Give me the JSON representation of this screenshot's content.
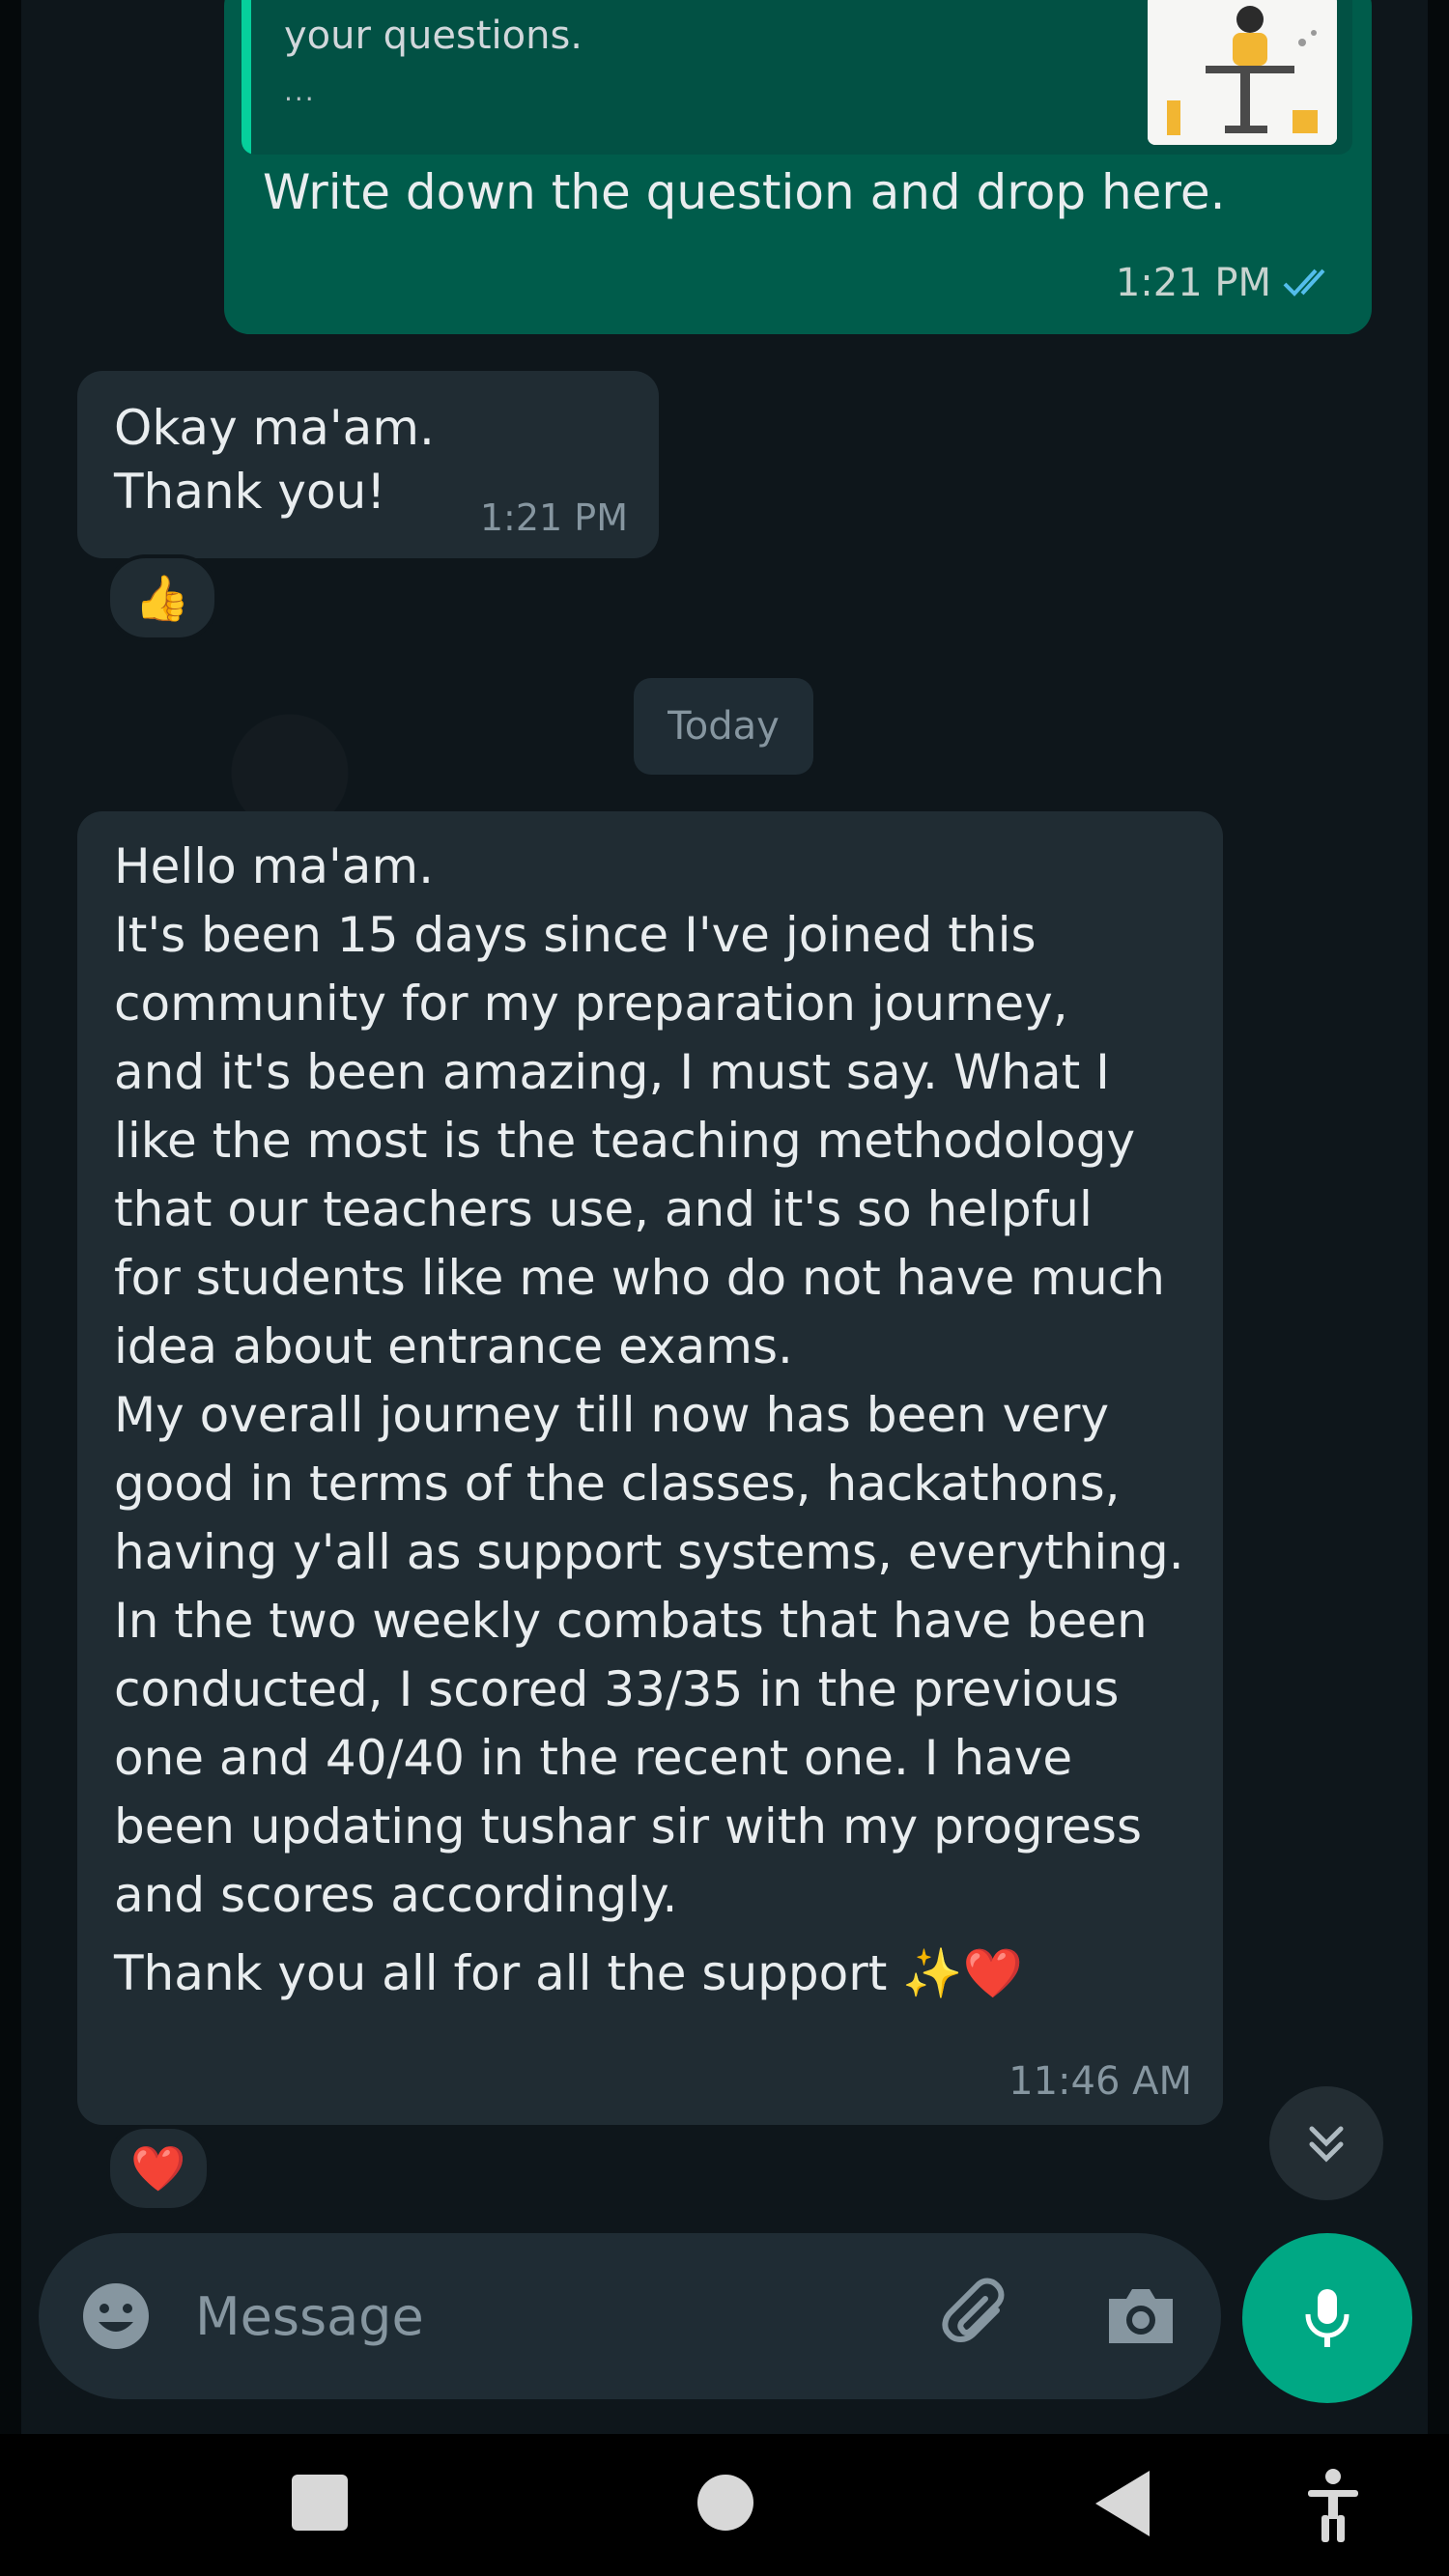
{
  "chat": {
    "outgoing": {
      "quoted_text": "your questions.",
      "quoted_ellipsis": "...",
      "text": "Write down the question and drop here.",
      "time": "1:21 PM",
      "status_icon": "double-check-read-icon"
    },
    "reply": {
      "lines": [
        "Okay ma'am.",
        "Thank you!"
      ],
      "time": "1:21 PM",
      "reaction": "👍"
    },
    "date_divider": "Today",
    "long_message": {
      "lines": [
        "Hello ma'am.",
        "It's been 15 days since I've joined this",
        "community for my preparation journey,",
        "and it's been amazing, I must say. What I",
        "like the most is the teaching methodology",
        "that our teachers use, and it's so helpful",
        "for students like me who do not have much",
        "idea about entrance exams.",
        "My overall journey till now has been very",
        "good in terms of the classes, hackathons,",
        "having y'all as support systems, everything.",
        "In the two weekly combats that have been",
        "conducted, I scored 33/35 in the previous",
        "one and 40/40 in the recent one. I have",
        "been updating tushar sir with my progress",
        "and scores accordingly."
      ],
      "closing": "Thank you all for all the support ✨❤️",
      "time": "11:46 AM",
      "reaction": "❤️"
    }
  },
  "composer": {
    "placeholder": "Message",
    "emoji_icon": "emoji-icon",
    "attach_icon": "paperclip-icon",
    "camera_icon": "camera-icon",
    "mic_icon": "microphone-icon"
  },
  "colors": {
    "outgoing_bubble": "#005c4b",
    "incoming_bubble": "#202c33",
    "accent": "#00a884",
    "read_ticks": "#53bdeb"
  }
}
